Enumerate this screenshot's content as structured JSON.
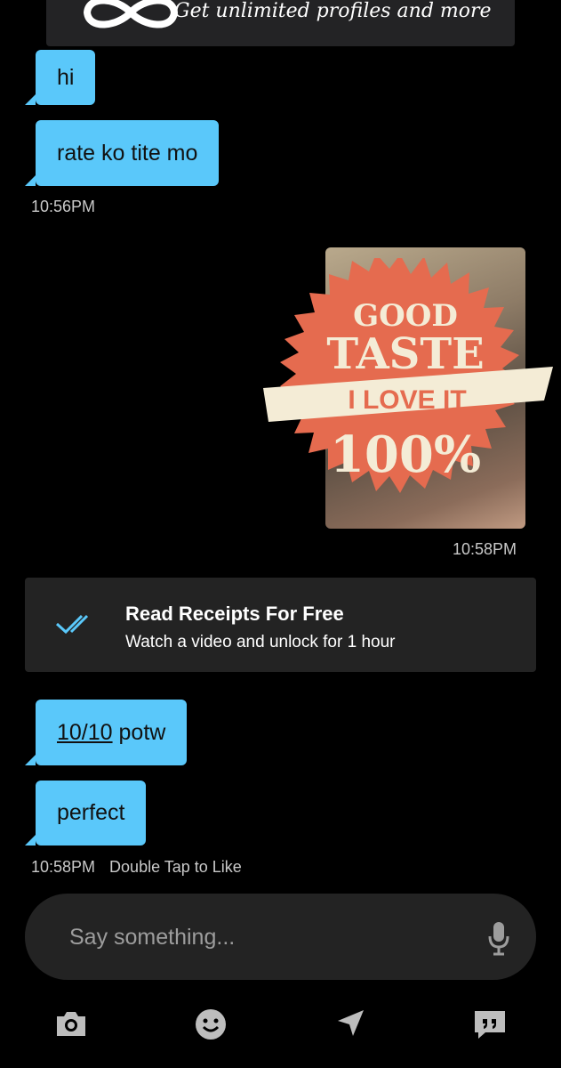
{
  "promo": {
    "text": "Get unlimited profiles and more",
    "icon": "infinity-icon"
  },
  "messages": [
    {
      "text": "hi"
    },
    {
      "text": "rate ko tite mo"
    }
  ],
  "timestamp_1": "10:56PM",
  "photo": {
    "sticker_line1": "GOOD",
    "sticker_line2": "TASTE",
    "sticker_ribbon": "I LOVE IT",
    "sticker_percent": "100%",
    "timestamp": "10:58PM"
  },
  "read_receipts": {
    "title": "Read Receipts For Free",
    "subtitle": "Watch a video and unlock for 1 hour",
    "icon": "double-check-icon"
  },
  "messages_2": [
    {
      "link": "10/10",
      "rest": " potw"
    },
    {
      "text": "perfect"
    }
  ],
  "timestamp_2": "10:58PM",
  "hint": "Double Tap to Like",
  "composer": {
    "placeholder": "Say something...",
    "icon": "microphone-icon"
  },
  "toolbar": [
    "camera-icon",
    "emoji-icon",
    "location-arrow-icon",
    "quick-replies-icon"
  ],
  "colors": {
    "bubble": "#5ac8fa",
    "sticker_orange": "#e56b4f",
    "sticker_cream": "#f4ecd6",
    "check_blue": "#5ac8fa"
  }
}
